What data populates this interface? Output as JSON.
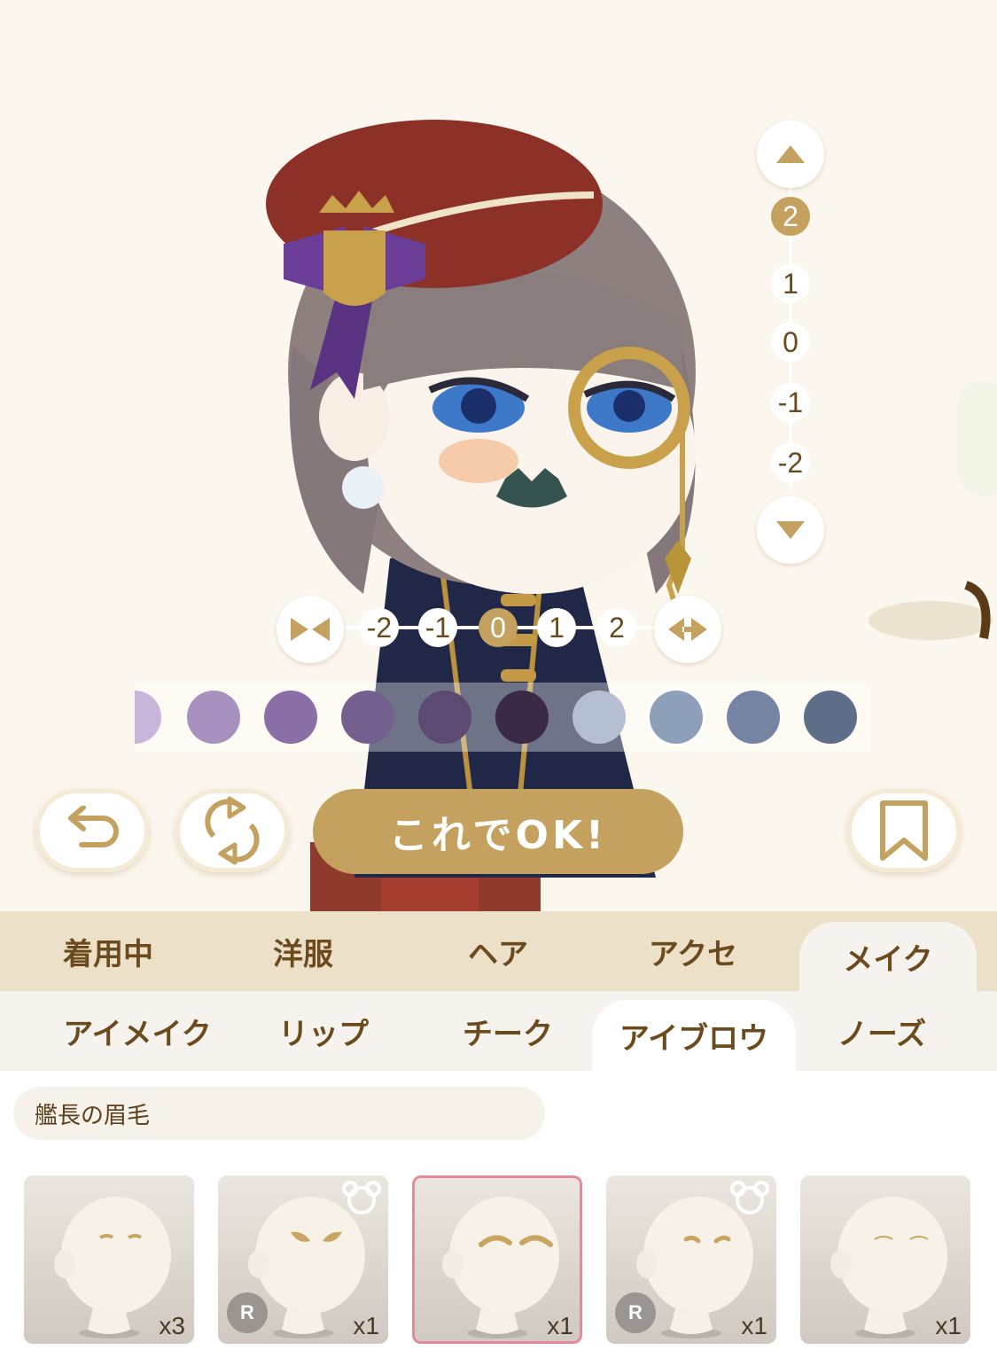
{
  "stage": {
    "vertical_slider": {
      "ticks": [
        "2",
        "1",
        "0",
        "-1",
        "-2"
      ],
      "selected": "2"
    },
    "horizontal_slider": {
      "ticks": [
        "-2",
        "-1",
        "0",
        "1",
        "2"
      ],
      "selected": "0"
    },
    "swatches": [
      {
        "color": "#c8b6da"
      },
      {
        "color": "#a792bf"
      },
      {
        "color": "#8a6ea6"
      },
      {
        "color": "#74608f"
      },
      {
        "color": "#5c4a72"
      },
      {
        "color": "#3a2a45"
      },
      {
        "color": "#b4c0d2"
      },
      {
        "color": "#8e9fba"
      },
      {
        "color": "#7584a2"
      },
      {
        "color": "#5e6e88"
      }
    ],
    "selected_swatch_index": 7,
    "ok_label": "これでOK!"
  },
  "main_tabs": [
    "着用中",
    "洋服",
    "ヘア",
    "アクセ",
    "メイク"
  ],
  "main_tab_active": "メイク",
  "sub_tabs": [
    "アイメイク",
    "リップ",
    "チーク",
    "アイブロウ",
    "ノーズ"
  ],
  "sub_tab_active": "アイブロウ",
  "item_name": "艦長の眉毛",
  "items": [
    {
      "count": "x3",
      "rare": null,
      "bear": false,
      "brow": "small"
    },
    {
      "count": "x1",
      "rare": "R",
      "bear": true,
      "brow": "bold"
    },
    {
      "count": "x1",
      "rare": null,
      "bear": false,
      "brow": "arched",
      "selected": true
    },
    {
      "count": "x1",
      "rare": "R",
      "bear": true,
      "brow": "short"
    },
    {
      "count": "x1",
      "rare": null,
      "bear": false,
      "brow": "thin"
    }
  ],
  "colors": {
    "gold": "#c4a15e",
    "text": "#6b4b1d",
    "tab_bg": "#ece0c9",
    "selected_border": "#e58a9a"
  }
}
